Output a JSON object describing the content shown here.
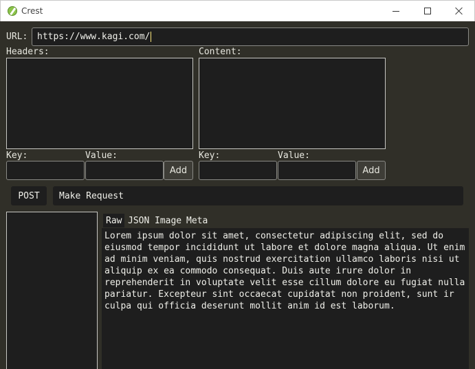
{
  "window": {
    "title": "Crest"
  },
  "request": {
    "url_label": "URL:",
    "url_value": "https://www.kagi.com/",
    "headers": {
      "label": "Headers:",
      "key_label": "Key:",
      "value_label": "Value:",
      "add_label": "Add"
    },
    "content": {
      "label": "Content:",
      "key_label": "Key:",
      "value_label": "Value:",
      "add_label": "Add"
    },
    "method": "POST",
    "submit_label": "Make Request"
  },
  "response": {
    "tabs": [
      "Raw",
      "JSON",
      "Image",
      "Meta"
    ],
    "active_tab": "Raw",
    "body": "Lorem ipsum dolor sit amet, consectetur adipiscing elit, sed do\neiusmod tempor incididunt ut labore et dolore magna aliqua. Ut enim\nad minim veniam, quis nostrud exercitation ullamco laboris nisi ut\naliquip ex ea commodo consequat. Duis aute irure dolor in\nreprehenderit in voluptate velit esse cillum dolore eu fugiat nulla\npariatur. Excepteur sint occaecat cupidatat non proident, sunt ir\nculpa qui officia deserunt mollit anim id est laborum."
  },
  "colors": {
    "background": "#302f28",
    "field": "#1e1e1e",
    "caret": "#ffe87c",
    "app_icon": "#8cc44a"
  }
}
